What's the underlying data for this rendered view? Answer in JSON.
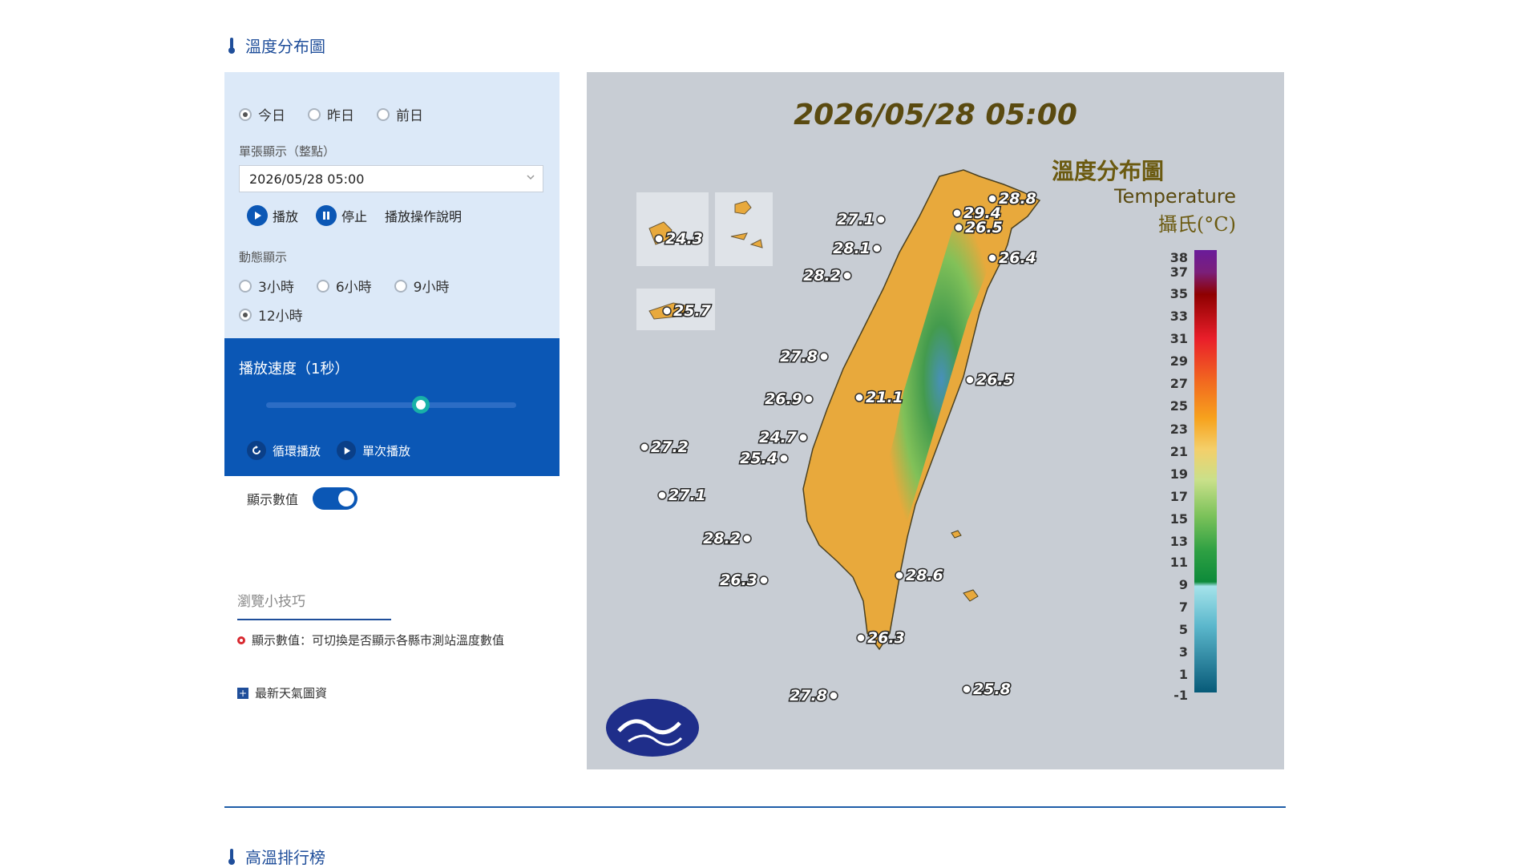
{
  "section": {
    "title": "溫度分布圖",
    "next_title": "高溫排行榜"
  },
  "controls": {
    "days": [
      {
        "label": "今日",
        "checked": true
      },
      {
        "label": "昨日",
        "checked": false
      },
      {
        "label": "前日",
        "checked": false
      }
    ],
    "time_label": "單張顯示（整點）",
    "time_value": "2026/05/28 05:00",
    "play_label": "播放",
    "stop_label": "停止",
    "help_label": "播放操作說明",
    "anim_label": "動態顯示",
    "anim_options": [
      {
        "label": "3小時",
        "checked": false
      },
      {
        "label": "6小時",
        "checked": false
      },
      {
        "label": "9小時",
        "checked": false
      },
      {
        "label": "12小時",
        "checked": true
      }
    ],
    "speed_label": "播放速度（1秒）",
    "speed_position": 0.62,
    "loop_label": "循環播放",
    "once_label": "單次播放",
    "show_values_label": "顯示數值",
    "show_values": true
  },
  "tips": {
    "title": "瀏覽小技巧",
    "item1": "顯示數值：可切換是否顯示各縣市測站溫度數值",
    "item2": "最新天氣圖資"
  },
  "map": {
    "timestamp": "2026/05/28 05:00",
    "legend_title": "溫度分布圖",
    "legend_subtitle": "Temperature",
    "legend_unit": "攝氏(°C)",
    "legend_ticks": [
      "38",
      "37",
      "35",
      "33",
      "31",
      "29",
      "27",
      "25",
      "23",
      "21",
      "19",
      "17",
      "15",
      "13",
      "11",
      "9",
      "7",
      "5",
      "3",
      "1",
      "-1"
    ],
    "stations": [
      {
        "value": "29.4"
      },
      {
        "value": "28.8"
      },
      {
        "value": "26.5"
      },
      {
        "value": "27.1"
      },
      {
        "value": "28.1"
      },
      {
        "value": "26.4"
      },
      {
        "value": "28.2"
      },
      {
        "value": "24.3"
      },
      {
        "value": "25.7"
      },
      {
        "value": "27.8"
      },
      {
        "value": "21.1"
      },
      {
        "value": "26.5"
      },
      {
        "value": "26.9"
      },
      {
        "value": "24.7"
      },
      {
        "value": "25.4"
      },
      {
        "value": "27.2"
      },
      {
        "value": "27.1"
      },
      {
        "value": "28.2"
      },
      {
        "value": "26.3"
      },
      {
        "value": "28.6"
      },
      {
        "value": "26.3"
      },
      {
        "value": "27.8"
      },
      {
        "value": "25.8"
      }
    ],
    "colors": {
      "warm": "#e8a93c",
      "mountain": "#52a84f",
      "peak": "#3f8fc2",
      "accent": "#0b57b5"
    }
  }
}
